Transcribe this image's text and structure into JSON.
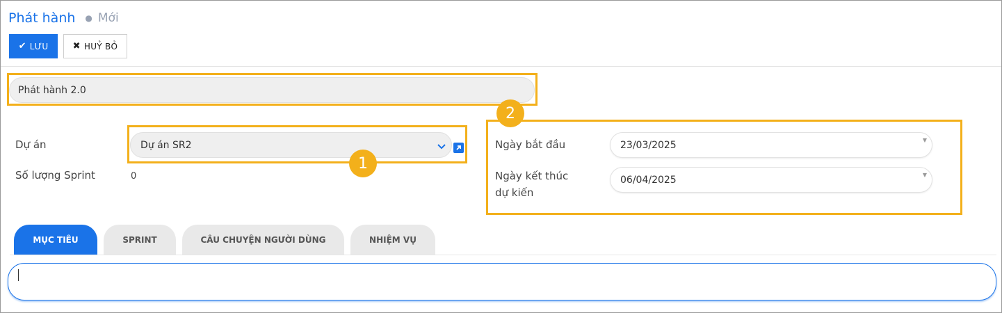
{
  "breadcrumb": {
    "title": "Phát hành",
    "current": "Mới"
  },
  "toolbar": {
    "save_label": "LƯU",
    "cancel_label": "HUỶ BỎ"
  },
  "form": {
    "name_value": "Phát hành 2.0",
    "project_label": "Dự án",
    "project_value": "Dự án SR2",
    "sprint_count_label": "Số lượng Sprint",
    "sprint_count_value": "0",
    "start_date_label": "Ngày bắt đầu",
    "start_date_value": "23/03/2025",
    "end_date_label_line1": "Ngày kết thúc",
    "end_date_label_line2": "dự kiến",
    "end_date_value": "06/04/2025"
  },
  "annotations": {
    "badge_1": "1",
    "badge_2": "2"
  },
  "tabs": [
    {
      "label": "MỤC TIÊU",
      "active": true
    },
    {
      "label": "SPRINT",
      "active": false
    },
    {
      "label": "CÂU CHUYỆN NGƯỜI DÙNG",
      "active": false
    },
    {
      "label": "NHIỆM VỤ",
      "active": false
    }
  ],
  "icons": {
    "save": "check-icon",
    "cancel": "x-icon",
    "dropdown": "chevron-down-icon",
    "external": "external-link-icon",
    "date": "caret-down-icon"
  },
  "colors": {
    "accent": "#1a73e8",
    "highlight": "#f3b01b"
  }
}
